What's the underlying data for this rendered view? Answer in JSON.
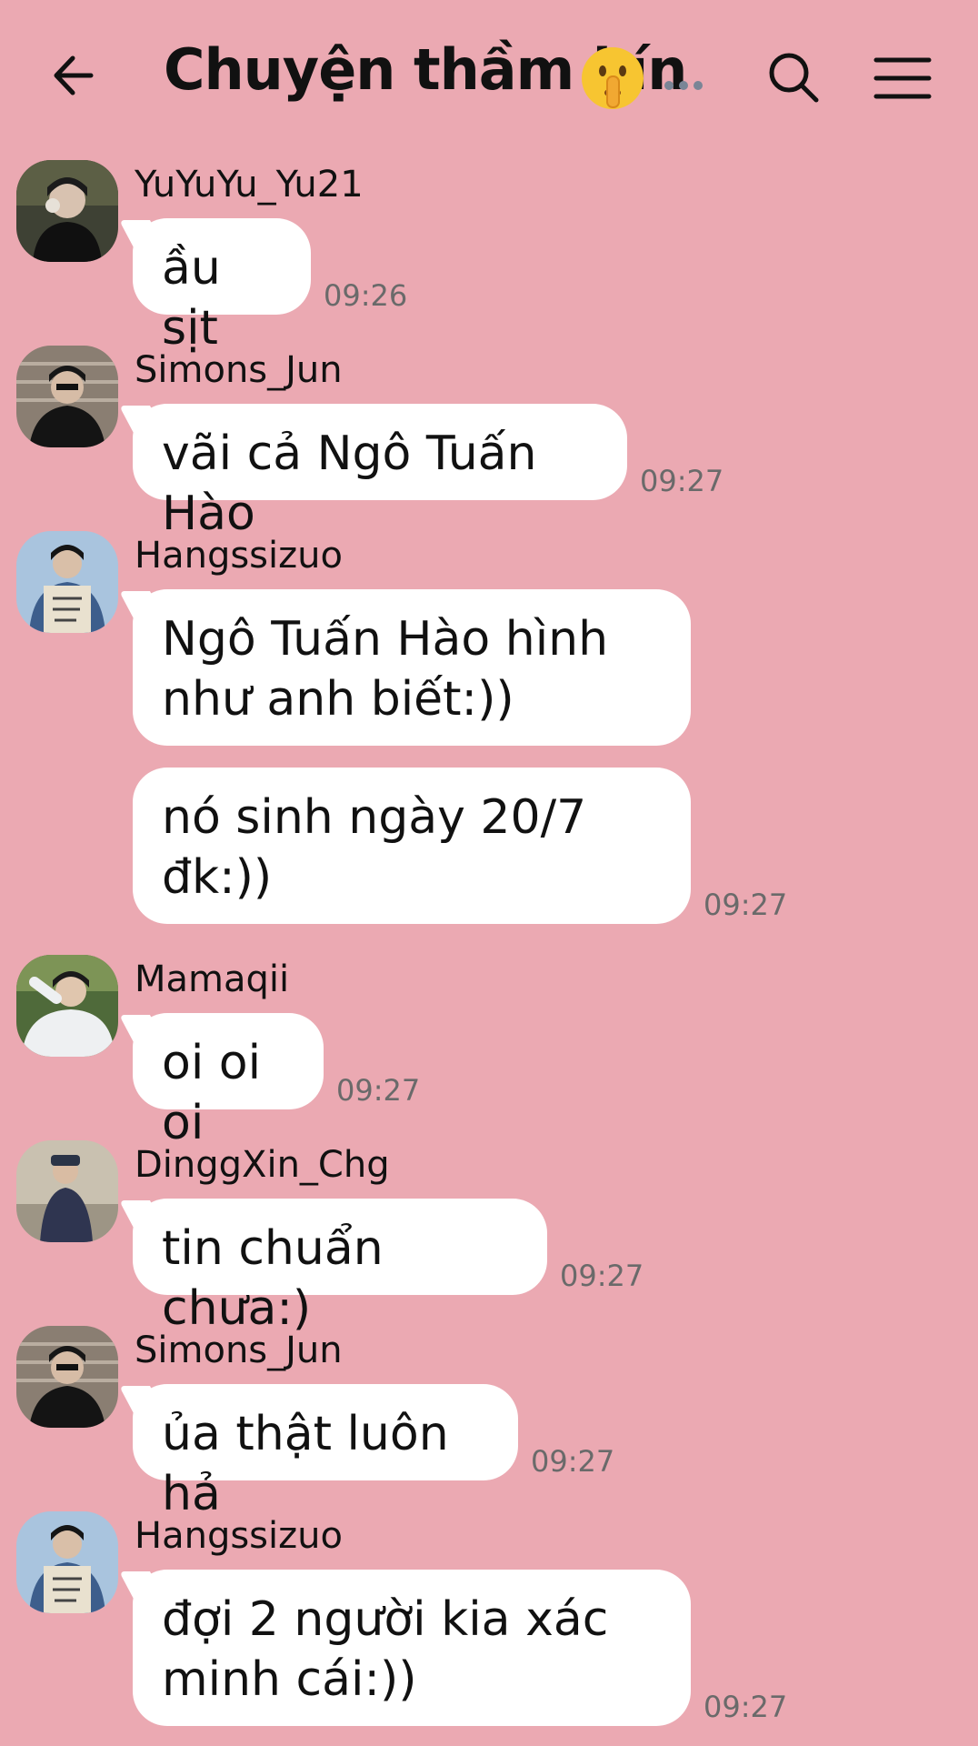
{
  "header": {
    "title": "Chuyện thầm kín",
    "title_emoji": "shushing-face-emoji",
    "more_indicator": "...",
    "back_icon": "back-arrow-icon",
    "search_icon": "search-icon",
    "menu_icon": "menu-icon"
  },
  "colors": {
    "background": "#eba9b2",
    "bubble": "#ffffff",
    "time": "#6a6a6a"
  },
  "messages": [
    {
      "sender": "YuYuYu_Yu21",
      "bubbles": [
        "ầu sịt"
      ],
      "time": "09:26"
    },
    {
      "sender": "Simons_Jun",
      "bubbles": [
        "vãi cả Ngô Tuấn Hào"
      ],
      "time": "09:27"
    },
    {
      "sender": "Hangssizuo",
      "bubbles": [
        "Ngô Tuấn Hào hình\nnhư anh biết:))",
        "nó sinh ngày 20/7\nđk:))"
      ],
      "time": "09:27"
    },
    {
      "sender": "Mamaqii",
      "bubbles": [
        "oi oi oi"
      ],
      "time": "09:27"
    },
    {
      "sender": "DinggXin_Chg",
      "bubbles": [
        "tin chuẩn chưa:)"
      ],
      "time": "09:27"
    },
    {
      "sender": "Simons_Jun",
      "bubbles": [
        "ủa thật luôn hả"
      ],
      "time": "09:27"
    },
    {
      "sender": "Hangssizuo",
      "bubbles": [
        "đợi 2 người kia xác\nminh cái:))"
      ],
      "time": "09:27"
    }
  ]
}
